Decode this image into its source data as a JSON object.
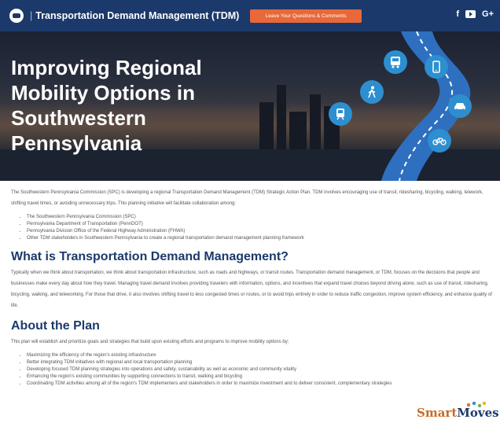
{
  "header": {
    "site_title": "Transportation Demand Management (TDM)",
    "cta_label": "Leave Your Questions & Comments",
    "social": {
      "facebook": "f",
      "google": "G+"
    }
  },
  "hero": {
    "title": "Improving Regional Mobility Options in Southwestern Pennsylvania"
  },
  "intro": {
    "paragraph": "The Southwestern Pennsylvania Commission (SPC) is developing a regional Transportation Demand Management (TDM) Strategic Action Plan. TDM involves encouraging use of transit, ridesharing, bicycling, walking, telework, shifting travel times, or avoiding unnecessary trips. This planning initiative will facilitate collaboration among:",
    "items": [
      "The Southwestern Pennsylvania Commission (SPC)",
      "Pennsylvania Department of Transportation (PennDOT)",
      "Pennsylvania Division Office of the Federal Highway Administration (FHWA)",
      "Other TDM stakeholders in Southwestern Pennsylvania to create a regional transportation demand management planning framework"
    ]
  },
  "what_is": {
    "heading": "What is Transportation Demand Management?",
    "paragraph": "Typically when we think about transportation, we think about transportation infrastructure, such as roads and highways, or transit routes. Transportation demand management, or TDM, focuses on the decisions that people and businesses make every day about how they travel. Managing travel demand involves providing travelers with information, options, and incentives that expand travel choices beyond driving alone, such as use of transit, ridesharing, bicycling, walking, and teleworking. For those that drive, it also involves shifting travel to less congested times or routes, or to avoid trips entirely in order to reduce traffic congestion, improve system efficiency, and enhance quality of life."
  },
  "about": {
    "heading": "About the Plan",
    "paragraph": "This plan will establish and prioritize goals and strategies that build upon existing efforts and programs to improve mobility options by:",
    "items": [
      "Maximizing the efficiency of the region's existing infrastructure",
      "Better integrating TDM initiatives with regional and local transportation planning",
      "Developing focused TDM planning strategies into operations and safety, sustainability as well as economic and community vitality",
      "Enhancing the region's existing communities by supporting connections to transit, walking and bicycling",
      "Coordinating TDM activities among all of the region's TDM implementers and stakeholders in order to maximize investment and to deliver consistent, complementary strategies"
    ]
  },
  "logo": {
    "smart": "Smart",
    "moves": "Moves"
  },
  "colors": {
    "header_bg": "#1b3a6b",
    "cta": "#e8683a",
    "heading": "#1b3a6b",
    "icon_circle": "#2d8fd0",
    "logo_orange": "#c86a28"
  }
}
